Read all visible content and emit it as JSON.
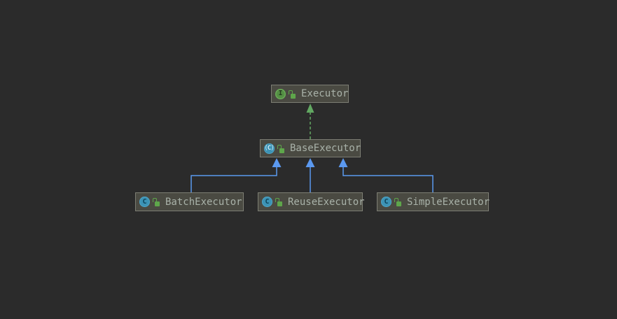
{
  "diagram": {
    "type": "uml-class-diagram",
    "background_color": "#2b2b2b",
    "node_fill_color": "#4a4a42",
    "node_border_color": "#7d7e74",
    "node_text_color": "#a9b2a9",
    "colors": {
      "extends_edge": "#5b99f0",
      "implements_edge": "#62a862",
      "interface_icon_green": "#549044",
      "class_icon_teal": "#3c93b5",
      "lock_icon_green": "#5ea64b"
    },
    "nodes": [
      {
        "label": "Executor",
        "kind": "interface",
        "icon_letter": "I",
        "visibility": "public"
      },
      {
        "label": "BaseExecutor",
        "kind": "abstract-class",
        "icon_letter": "C",
        "visibility": "public"
      },
      {
        "label": "BatchExecutor",
        "kind": "class",
        "icon_letter": "C",
        "visibility": "public"
      },
      {
        "label": "ReuseExecutor",
        "kind": "class",
        "icon_letter": "C",
        "visibility": "public"
      },
      {
        "label": "SimpleExecutor",
        "kind": "class",
        "icon_letter": "C",
        "visibility": "public"
      }
    ],
    "edges": [
      {
        "from": "BaseExecutor",
        "to": "Executor",
        "relation": "implements",
        "line_style": "dashed"
      },
      {
        "from": "BatchExecutor",
        "to": "BaseExecutor",
        "relation": "extends",
        "line_style": "solid"
      },
      {
        "from": "ReuseExecutor",
        "to": "BaseExecutor",
        "relation": "extends",
        "line_style": "solid"
      },
      {
        "from": "SimpleExecutor",
        "to": "BaseExecutor",
        "relation": "extends",
        "line_style": "solid"
      }
    ]
  }
}
